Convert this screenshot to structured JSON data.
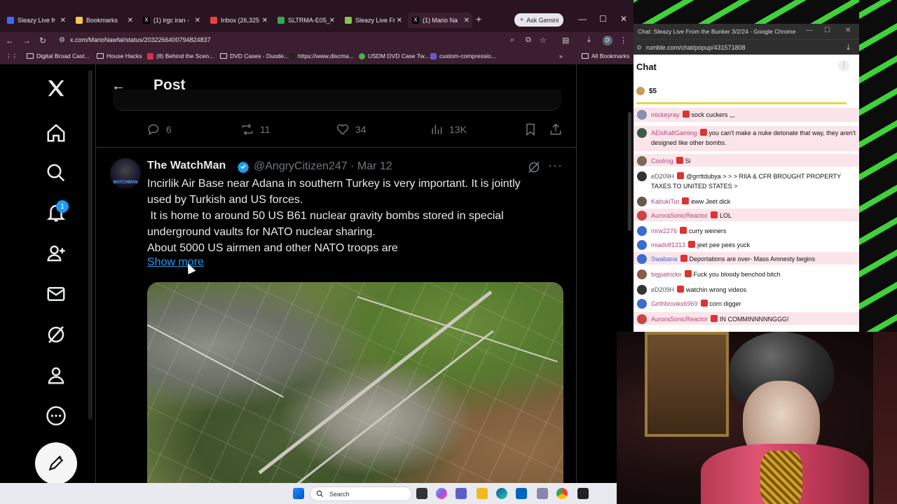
{
  "browser": {
    "tabs": [
      {
        "label": "Sleazy Live fr",
        "color": "#3b6cff"
      },
      {
        "label": "Bookmarks",
        "color": "#f2c94c"
      },
      {
        "label": "(1) irgc iran -",
        "color": "#ffffff"
      },
      {
        "label": "Inbox (26,325",
        "color": "#ea4335"
      },
      {
        "label": "SLTRMA-E05_",
        "color": "#34a853"
      },
      {
        "label": "Sleazy Live Fr",
        "color": "#85c742"
      },
      {
        "label": "(1) Mario Na",
        "color": "#ffffff"
      }
    ],
    "ask_gemini": "Ask Gemini",
    "url": "x.com/MarioNawfal/status/2032266400794824837",
    "bookmarks": [
      "Digital Broad Cast...",
      "House Hacks",
      "(8) Behind the Scen...",
      "DVD Cases - Duode...",
      "https://www.discma...",
      "USDM DVD Case Tw...",
      "custom-compressio..."
    ],
    "all_bookmarks": "All Bookmarks"
  },
  "x": {
    "header_title": "Post",
    "notifications_badge": "1",
    "prev_actions": {
      "replies": "6",
      "reposts": "11",
      "likes": "34",
      "views": "13K"
    },
    "post": {
      "author_name": "The WatchMan",
      "handle_date": "@AngryCitizen247 · Mar 12",
      "avatar_text": "WATCHMAN",
      "lines": [
        "Incirlik Air Base near Adana in southern Turkey is very important. It is jointly",
        "used by Turkish and US forces.",
        " It is home to around 50 US B61 nuclear gravity bombs stored in special",
        "underground vaults for NATO nuclear sharing.",
        "About 5000 US airmen and other NATO troops are"
      ],
      "show_more": "Show more"
    }
  },
  "chat": {
    "window_title": "Chat: Sleazy Live From the Bunker 3/2/24 - Google Chrome",
    "url": "rumble.com/chat/popup/431571808",
    "header": "Chat",
    "donation": "$5",
    "messages": [
      {
        "user": "mickeyray",
        "text": "sock cuckers ,,,",
        "ucolor": "#b0487a",
        "av": "#8a8fb0",
        "hl": true
      },
      {
        "user": "AEisKaltGaming",
        "text": "you can't make a nuke detonate that way, they aren't designed like other bombs.",
        "ucolor": "#b0487a",
        "av": "#3a5a4a",
        "hl": true
      },
      {
        "user": "Coolrog",
        "text": "Si",
        "ucolor": "#b0487a",
        "av": "#7a6a5a",
        "hl": true
      },
      {
        "user": "eD209H",
        "text": "@grrttdubya > > > RIIA & CFR BROUGHT PROPERTY TAXES TO UNITED STATES >",
        "ucolor": "#555",
        "av": "#333",
        "hl": false
      },
      {
        "user": "KabukiTut",
        "text": "eww Jeet dick",
        "ucolor": "#b0487a",
        "av": "#6a5a4a",
        "hl": false
      },
      {
        "user": "AuroraSonicReactor",
        "text": "LOL",
        "ucolor": "#b0487a",
        "av": "#c44",
        "hl": true
      },
      {
        "user": "mrw2276",
        "text": "curry weiners",
        "ucolor": "#b0487a",
        "av": "#3b6ccf",
        "hl": false
      },
      {
        "user": "miadolf1313",
        "text": "jeet pee pees yuck",
        "ucolor": "#b0487a",
        "av": "#3b6ccf",
        "hl": false
      },
      {
        "user": "Swabana",
        "text": "Deportations are over- Mass Amnesty begins",
        "ucolor": "#3b6ccf",
        "av": "#3b6ccf",
        "hl": true
      },
      {
        "user": "bigpatricko",
        "text": "Fuck you bloody benchod bitch",
        "ucolor": "#b0487a",
        "av": "#8a5a4a",
        "hl": false
      },
      {
        "user": "eD209H",
        "text": "watchin wrong videos",
        "ucolor": "#555",
        "av": "#333",
        "hl": false
      },
      {
        "user": "Girthbrooks6969",
        "text": "corn digger",
        "ucolor": "#b0487a",
        "av": "#3b6ccf",
        "hl": false
      },
      {
        "user": "AuroraSonicReactor",
        "text": "IN COMMINNNNNGGG!",
        "ucolor": "#b0487a",
        "av": "#c44",
        "hl": true
      }
    ]
  },
  "taskbar": {
    "search_placeholder": "Search"
  },
  "colors": {
    "x_blue": "#1d9bf0",
    "chat_highlight": "#fbe4ea",
    "stripe_green": "#3fd23a"
  }
}
